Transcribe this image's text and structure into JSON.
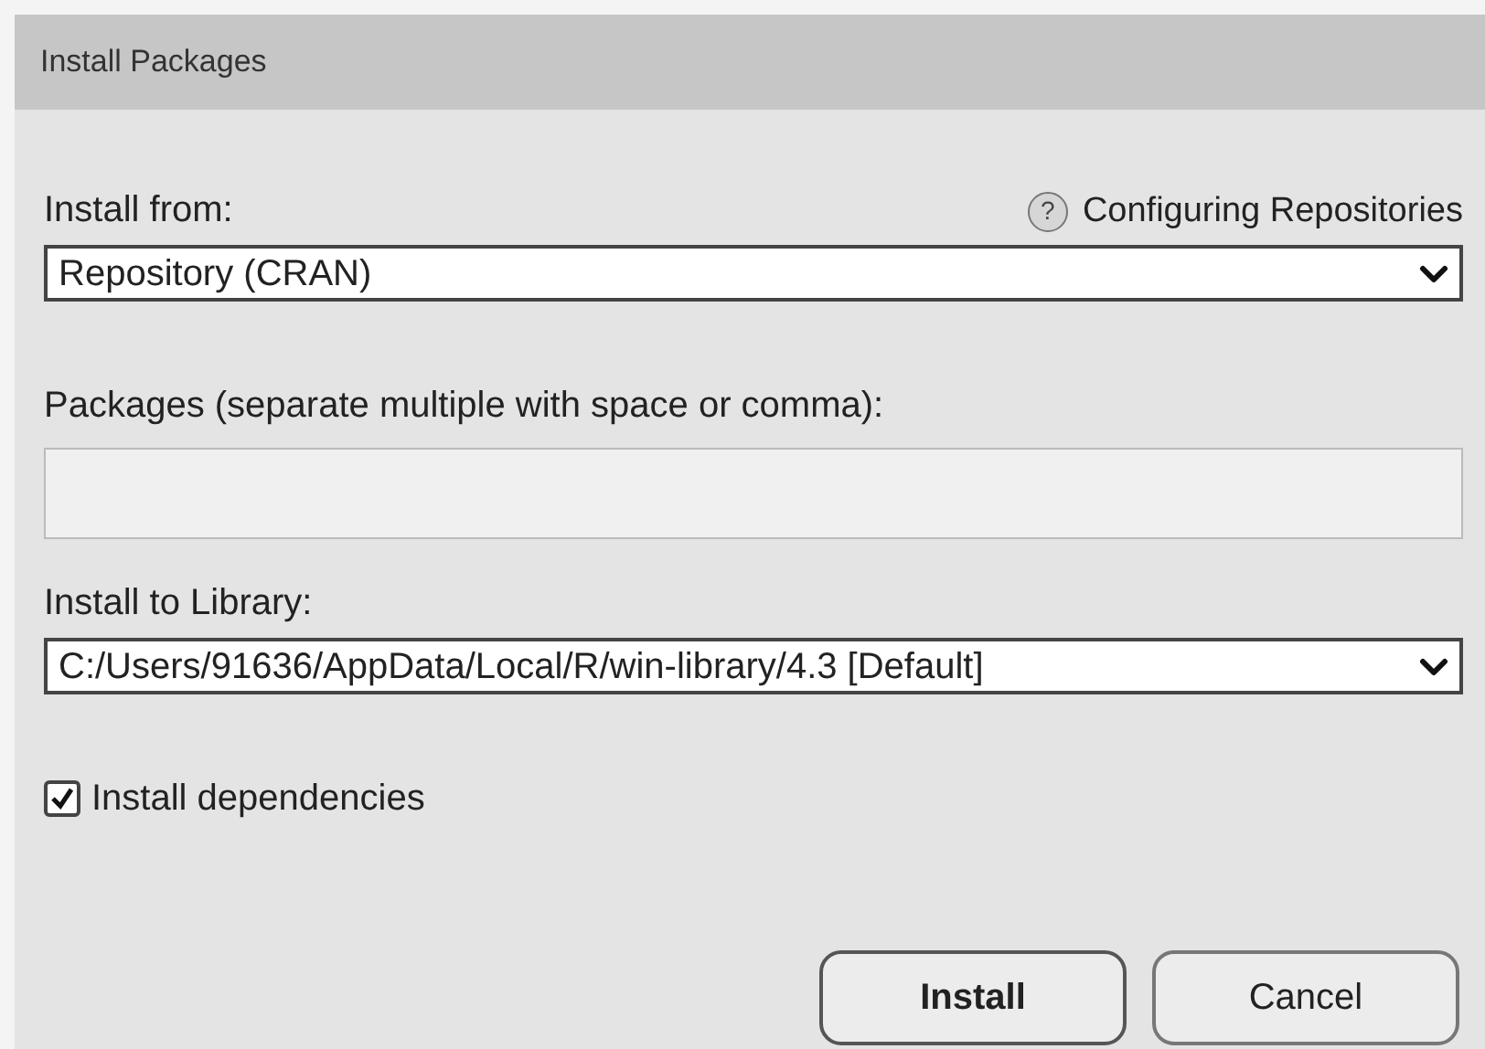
{
  "window": {
    "title": "Install Packages"
  },
  "install_from": {
    "label": "Install from:",
    "help_icon": "?",
    "help_link": "Configuring Repositories",
    "value": "Repository (CRAN)"
  },
  "packages": {
    "label": "Packages (separate multiple with space or comma):"
  },
  "library": {
    "label": "Install to Library:",
    "value": "C:/Users/91636/AppData/Local/R/win-library/4.3 [Default]"
  },
  "dependencies": {
    "label": "Install dependencies",
    "checked": true
  },
  "buttons": [
    {
      "label": "Install",
      "default": true
    },
    {
      "label": "Cancel",
      "default": false
    }
  ]
}
